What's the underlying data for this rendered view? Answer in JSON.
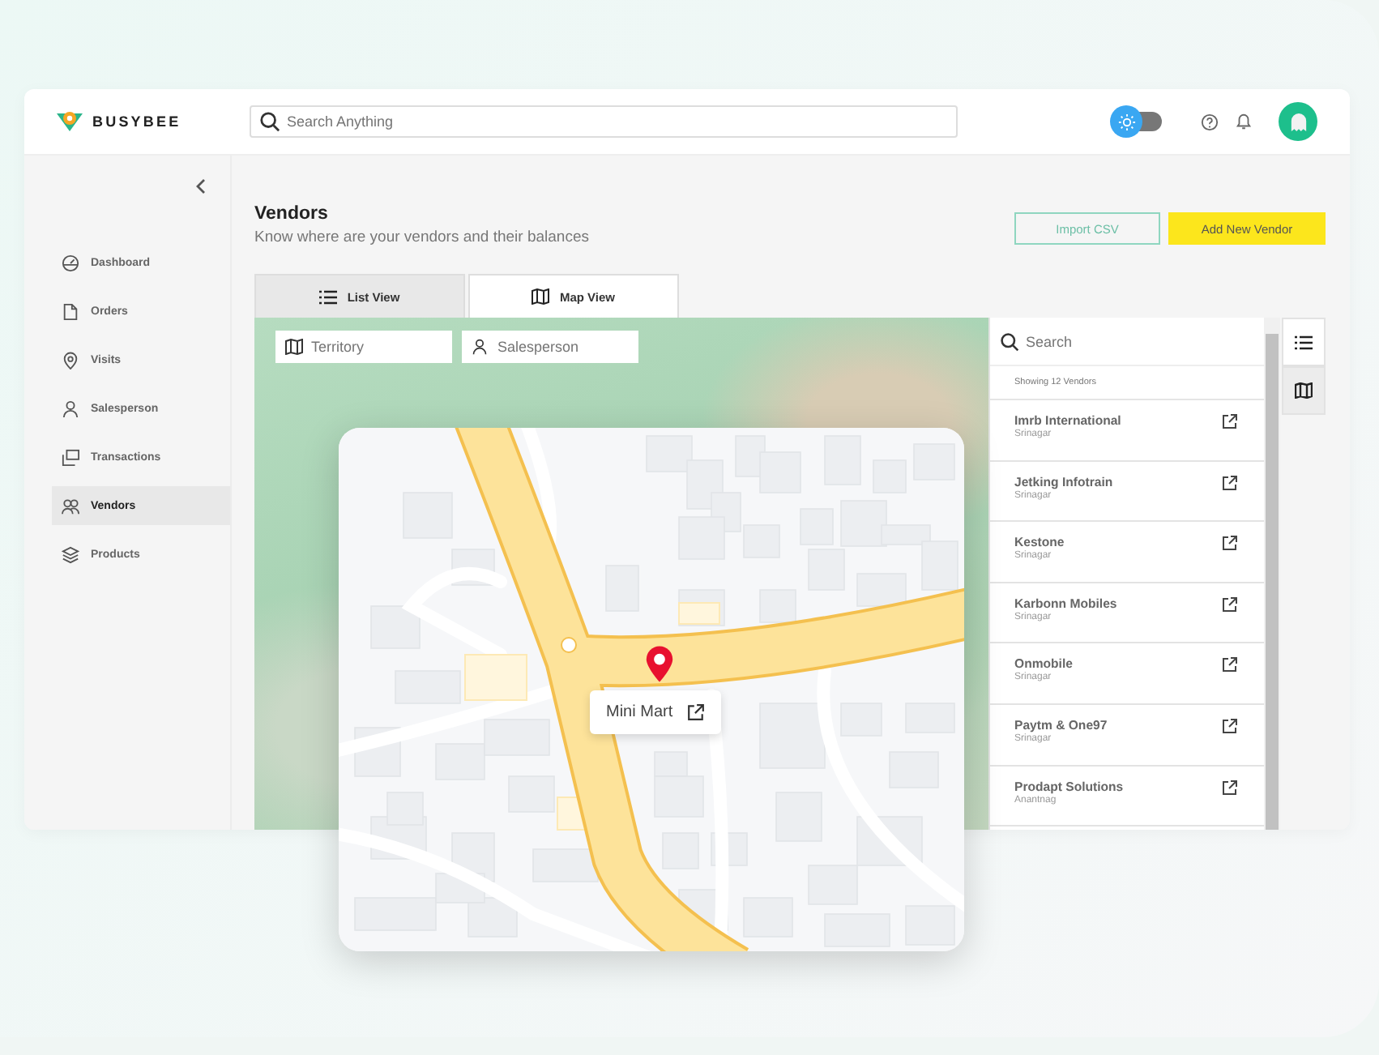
{
  "brand": {
    "name": "BUSYBEE"
  },
  "header": {
    "search": {
      "placeholder": "Search Anything"
    },
    "theme_toggle": {
      "on": false
    }
  },
  "sidebar": {
    "items": [
      {
        "label": "Dashboard",
        "selected": false
      },
      {
        "label": "Orders",
        "selected": false
      },
      {
        "label": "Visits",
        "selected": false
      },
      {
        "label": "Salesperson",
        "selected": false
      },
      {
        "label": "Transactions",
        "selected": false
      },
      {
        "label": "Vendors",
        "selected": true
      },
      {
        "label": "Products",
        "selected": false
      }
    ]
  },
  "page": {
    "title": "Vendors",
    "subtitle": "Know where are your vendors and their balances"
  },
  "buttons": [
    {
      "label": "Import CSV",
      "kind": "outline"
    },
    {
      "label": "Add New Vendor",
      "kind": "primary"
    }
  ],
  "tabs": [
    {
      "label": "List View",
      "selected": false
    },
    {
      "label": "Map View",
      "selected": true
    }
  ],
  "map_filters": [
    {
      "placeholder": "Territory"
    },
    {
      "placeholder": "Salesperson"
    }
  ],
  "vendor_list": {
    "search": {
      "placeholder": "Search"
    },
    "count": "Showing 12 Vendors",
    "vendors": [
      {
        "name": "Imrb International",
        "city": "Srinagar"
      },
      {
        "name": "Jetking Infotrain",
        "city": "Srinagar"
      },
      {
        "name": "Kestone",
        "city": "Srinagar"
      },
      {
        "name": "Karbonn Mobiles",
        "city": "Srinagar"
      },
      {
        "name": "Onmobile",
        "city": "Srinagar"
      },
      {
        "name": "Paytm & One97",
        "city": "Srinagar"
      },
      {
        "name": "Prodapt Solutions",
        "city": "Anantnag"
      }
    ]
  },
  "view_switch": [
    {
      "selected": false
    },
    {
      "selected": true
    }
  ],
  "map_popup": {
    "label": "Mini Mart"
  }
}
